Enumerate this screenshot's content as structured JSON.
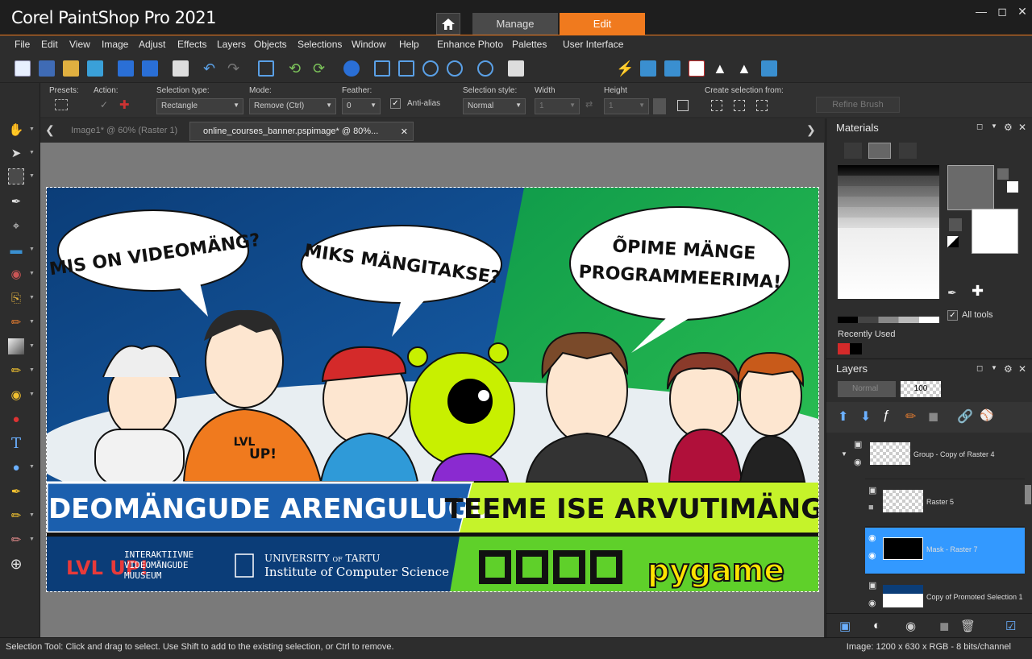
{
  "app": {
    "title": "Corel PaintShop Pro 2021"
  },
  "workspace_tabs": {
    "manage": "Manage",
    "edit": "Edit"
  },
  "menu": [
    "File",
    "Edit",
    "View",
    "Image",
    "Adjust",
    "Effects",
    "Layers",
    "Objects",
    "Selections",
    "Window",
    "Help",
    "Enhance Photo",
    "Palettes",
    "User Interface"
  ],
  "options": {
    "presets_label": "Presets:",
    "action_label": "Action:",
    "selection_type_label": "Selection type:",
    "selection_type_value": "Rectangle",
    "mode_label": "Mode:",
    "mode_value": "Remove (Ctrl)",
    "feather_label": "Feather:",
    "feather_value": "0",
    "antialias_label": "Anti-alias",
    "selection_style_label": "Selection style:",
    "selection_style_value": "Normal",
    "width_label": "Width",
    "width_value": "1",
    "height_label": "Height",
    "height_value": "1",
    "create_from_label": "Create selection from:",
    "refine_brush": "Refine Brush"
  },
  "doc_tabs": {
    "tab1": "Image1* @  60% (Raster 1)",
    "tab2": "online_courses_banner.pspimage* @  80%..."
  },
  "banner": {
    "bubble1": "MIS ON VIDEOMÄNG?",
    "bubble2": "MIKS MÄNGITAKSE?",
    "bubble3_line1": "ÕPIME MÄNGE",
    "bubble3_line2": "PROGRAMMEERIMA!",
    "strip_left": "VIDEOMÄNGUDE ARENGULUGU",
    "strip_right": "TEEME ISE ARVUTIMÄNGE",
    "museum_logo": "LVL UP!",
    "museum_line1": "INTERAKTIIVNE",
    "museum_line2": "VIDEOMÄNGUDE",
    "museum_line3": "MUUSEUM",
    "uni_line1": "UNIVERSITY",
    "uni_of": "OF",
    "uni_tartu": "TARTU",
    "uni_line2": "Institute of Computer Science",
    "pygame": "pygame",
    "shirt_text_1": "LVL",
    "shirt_text_2": "UP!"
  },
  "materials": {
    "title": "Materials",
    "all_tools": "All tools",
    "recently_used": "Recently Used",
    "recent_colors": [
      "#d42a2a",
      "#000000"
    ]
  },
  "layers": {
    "title": "Layers",
    "blend_mode": "Normal",
    "opacity": "100",
    "rows": [
      {
        "name": "Group - Copy of Raster 4"
      },
      {
        "name": "Raster 5"
      },
      {
        "name": "Mask - Raster 7"
      },
      {
        "name": "Copy of Promoted Selection 1"
      }
    ]
  },
  "status": {
    "hint": "Selection Tool: Click and drag to select. Use Shift to add to the existing selection, or Ctrl to remove.",
    "image_info": "Image:  1200 x 630 x RGB - 8 bits/channel"
  },
  "colors": {
    "accent": "#f07a1e",
    "selection_blue": "#3399ff"
  }
}
